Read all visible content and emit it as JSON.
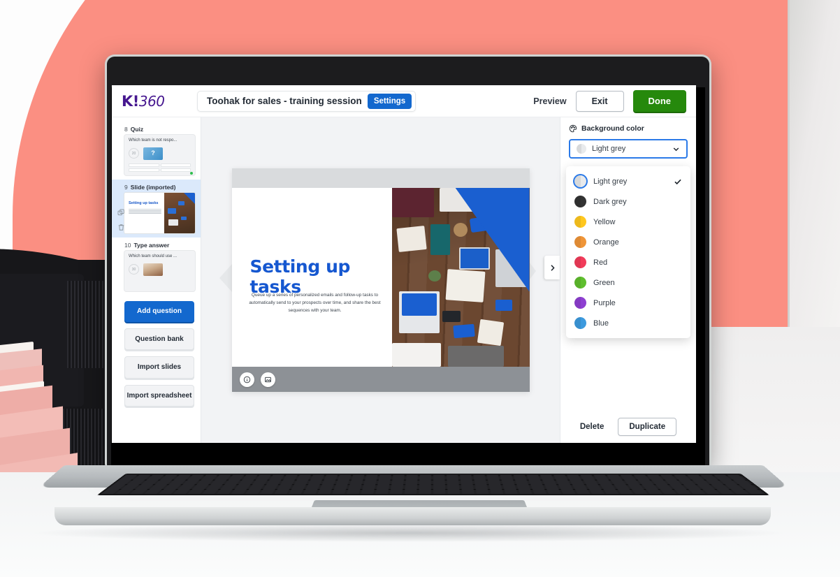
{
  "app": {
    "logo_mark": "K!",
    "logo_suffix": "360"
  },
  "topbar": {
    "presentation_title": "Toohak for sales - training session",
    "settings_label": "Settings",
    "preview_label": "Preview",
    "exit_label": "Exit",
    "done_label": "Done"
  },
  "sidebar": {
    "slides": [
      {
        "number": "8",
        "type": "Quiz",
        "question": "Which team is not respo...",
        "timer": "20",
        "selected": false
      },
      {
        "number": "9",
        "type": "Slide (imported)",
        "thumb_title": "Setting up tasks",
        "selected": true
      },
      {
        "number": "10",
        "type": "Type answer",
        "question": "Which team should use ...",
        "timer": "30",
        "selected": false
      }
    ],
    "buttons": [
      {
        "label": "Add question",
        "style": "primary"
      },
      {
        "label": "Question bank",
        "style": "plain"
      },
      {
        "label": "Import slides",
        "style": "plain"
      },
      {
        "label": "Import spreadsheet",
        "style": "plain"
      }
    ]
  },
  "slide": {
    "title": "Setting up tasks",
    "body": "Queue up a series of personalized emails and follow-up tasks to automatically send to your prospects over time, and share the best sequences with your team.",
    "toolbar": {
      "info_icon": "info-icon",
      "media_icon": "image-icon"
    },
    "next_icon": "chevron-right-icon"
  },
  "right_panel": {
    "header": "Background color",
    "header_icon": "palette-icon",
    "selected_value": "Light grey",
    "selected_color": "#e8eaec",
    "options": [
      {
        "label": "Light grey",
        "color": "#e8eaec",
        "checked": true
      },
      {
        "label": "Dark grey",
        "color": "#333333",
        "checked": false
      },
      {
        "label": "Yellow",
        "color": "#ffc71f",
        "checked": false
      },
      {
        "label": "Orange",
        "color": "#ef9538",
        "checked": false
      },
      {
        "label": "Red",
        "color": "#f13c5a",
        "checked": false
      },
      {
        "label": "Green",
        "color": "#5fbe2e",
        "checked": false
      },
      {
        "label": "Purple",
        "color": "#8e3fd1",
        "checked": false
      },
      {
        "label": "Blue",
        "color": "#3d9ade",
        "checked": false
      }
    ],
    "delete_label": "Delete",
    "duplicate_label": "Duplicate"
  },
  "theme": {
    "brand_purple": "#46178f",
    "blue": "#1368ce",
    "green": "#26890c",
    "coral_background": "#fb8f82"
  }
}
